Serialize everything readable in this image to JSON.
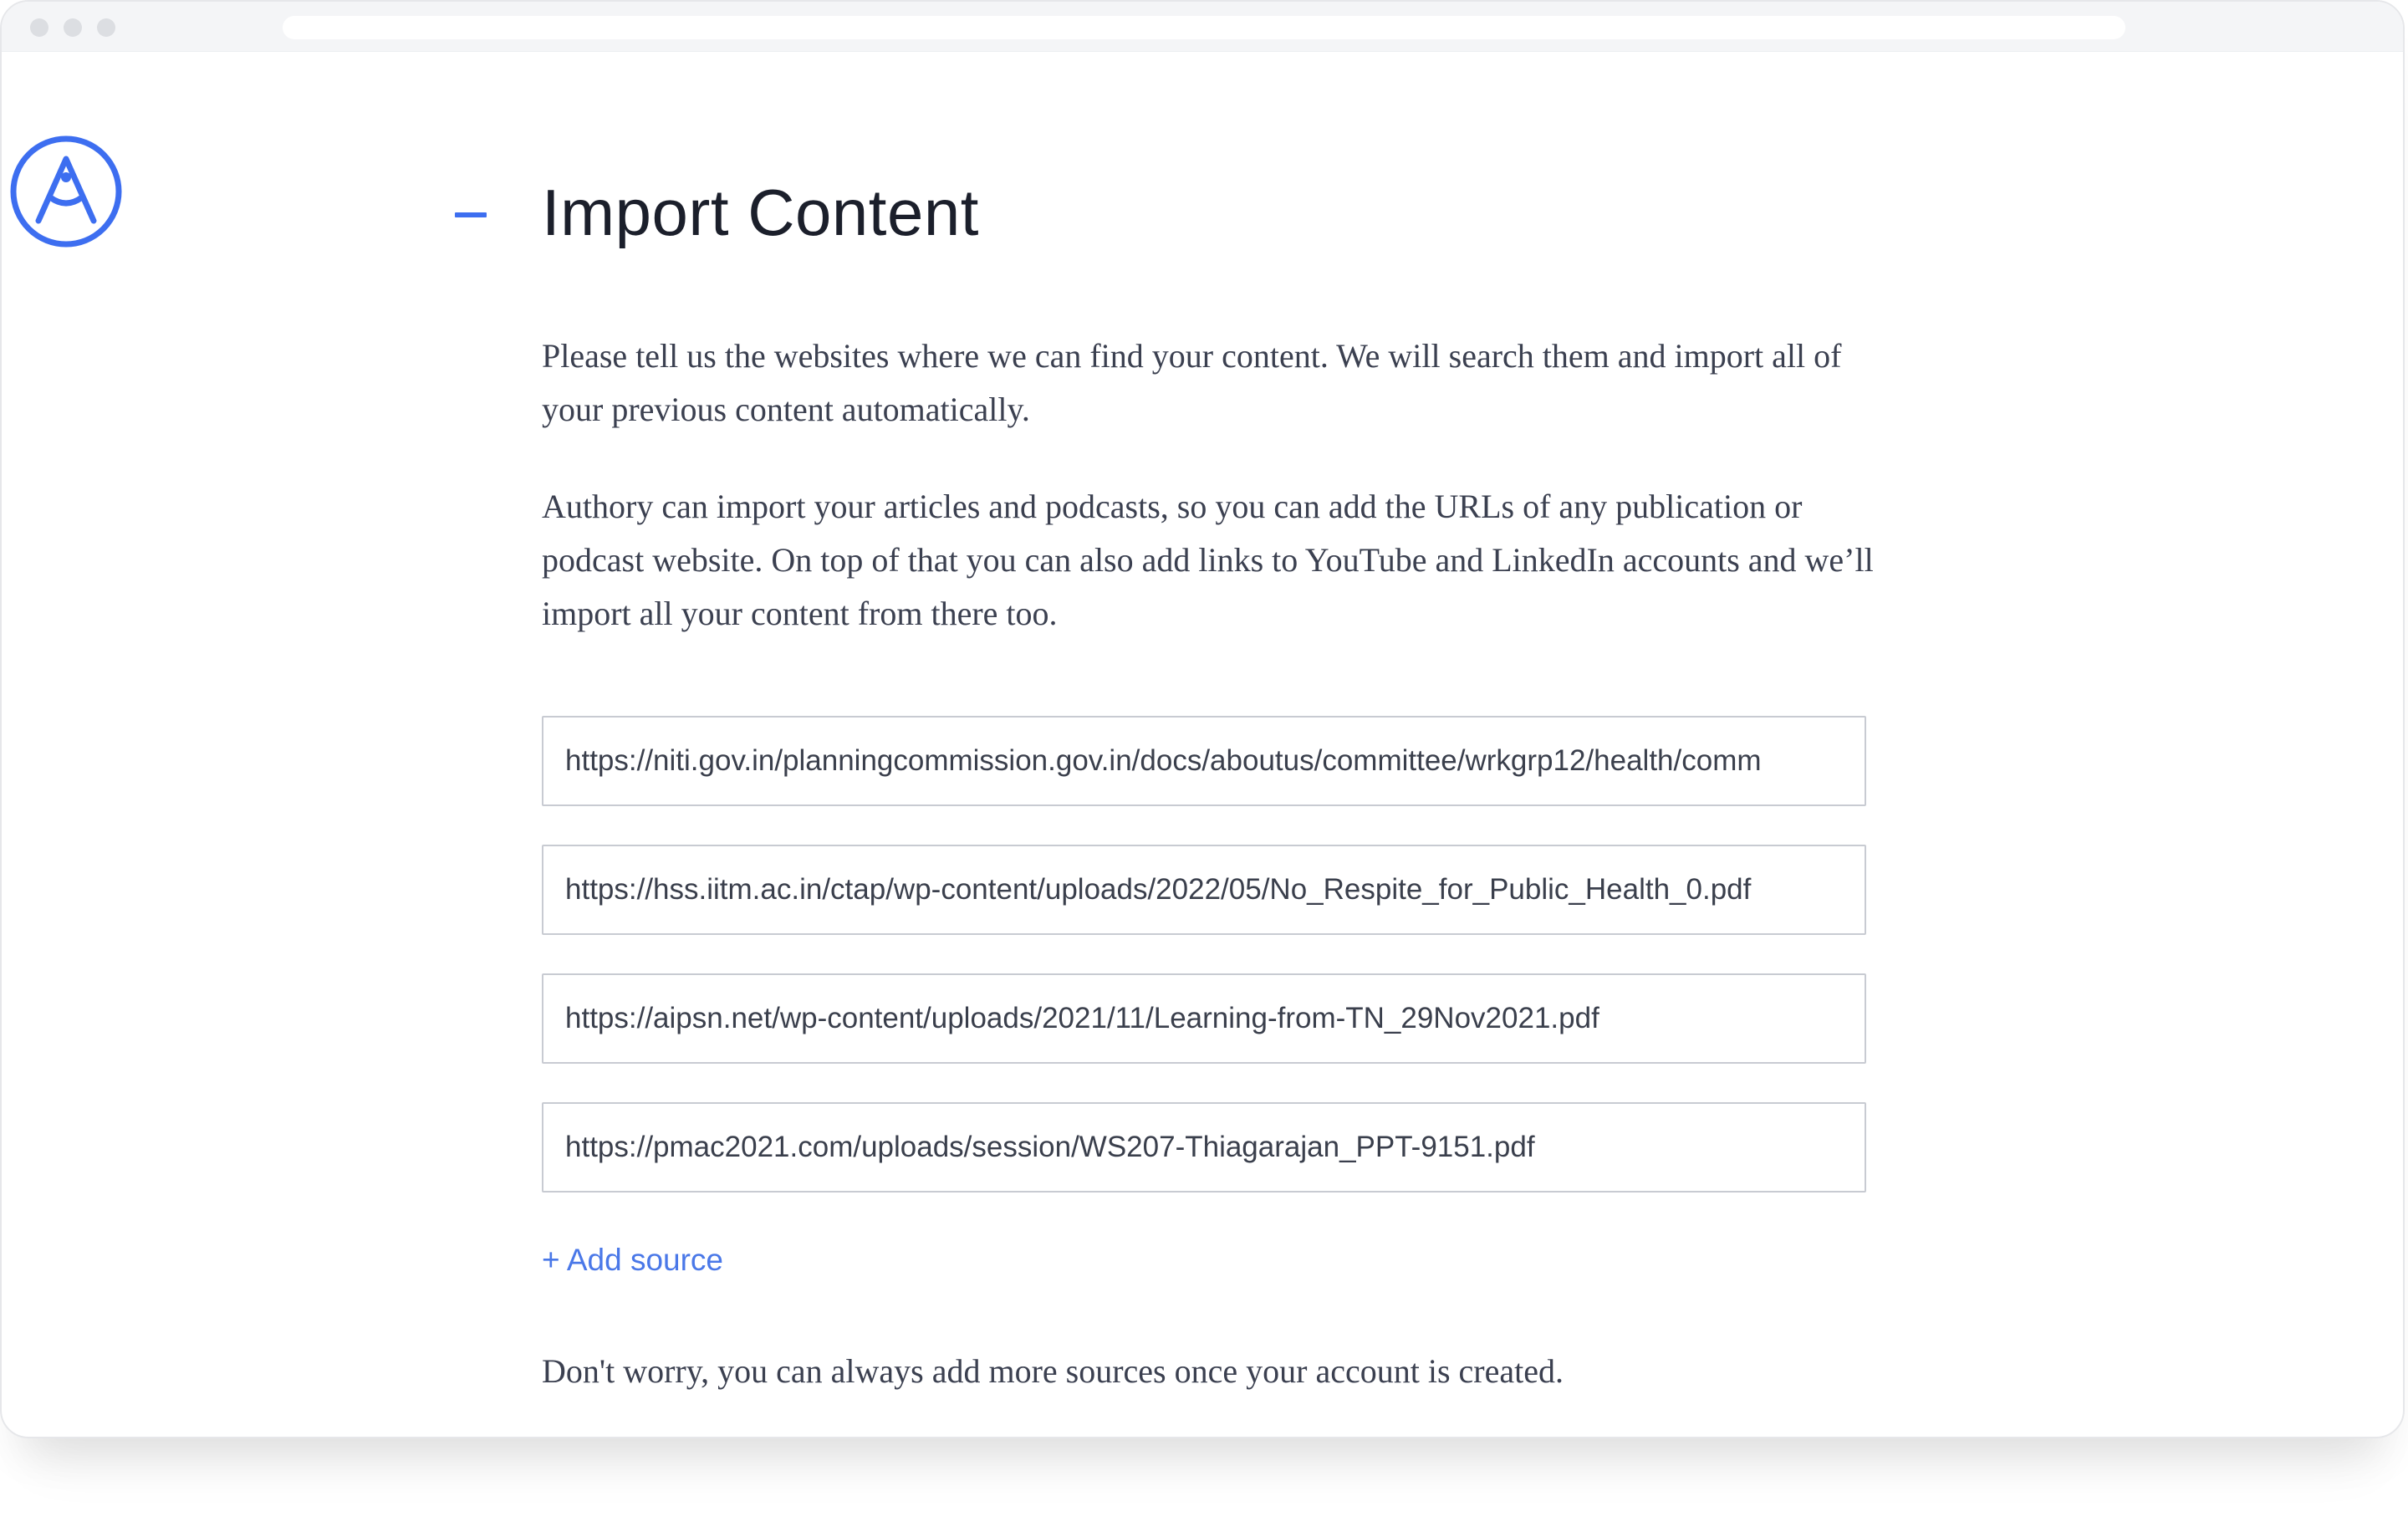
{
  "header": {
    "logo_icon": "authory-logo-icon",
    "collapse_icon": "minus-icon",
    "title": "Import Content"
  },
  "intro": {
    "paragraph_1": "Please tell us the websites where we can find your content. We will search them and import all of your previous content automatically.",
    "paragraph_2": "Authory can import your articles and podcasts, so you can add the URLs of any publication or podcast website. On top of that you can also add links to YouTube and LinkedIn accounts and we’ll import all your content from there too."
  },
  "sources": [
    {
      "value": "https://niti.gov.in/planningcommission.gov.in/docs/aboutus/committee/wrkgrp12/health/comm"
    },
    {
      "value": "https://hss.iitm.ac.in/ctap/wp-content/uploads/2022/05/No_Respite_for_Public_Health_0.pdf"
    },
    {
      "value": "https://aipsn.net/wp-content/uploads/2021/11/Learning-from-TN_29Nov2021.pdf"
    },
    {
      "value": "https://pmac2021.com/uploads/session/WS207-Thiagarajan_PPT-9151.pdf"
    }
  ],
  "add_source_label": "+ Add source",
  "footnote": "Don't worry, you can always add more sources once your account is created.",
  "colors": {
    "accent": "#3d6ef0",
    "link": "#4a78e8",
    "title": "#1b1f2b",
    "body_text": "#3b4050",
    "input_border": "#c8cbd2"
  }
}
